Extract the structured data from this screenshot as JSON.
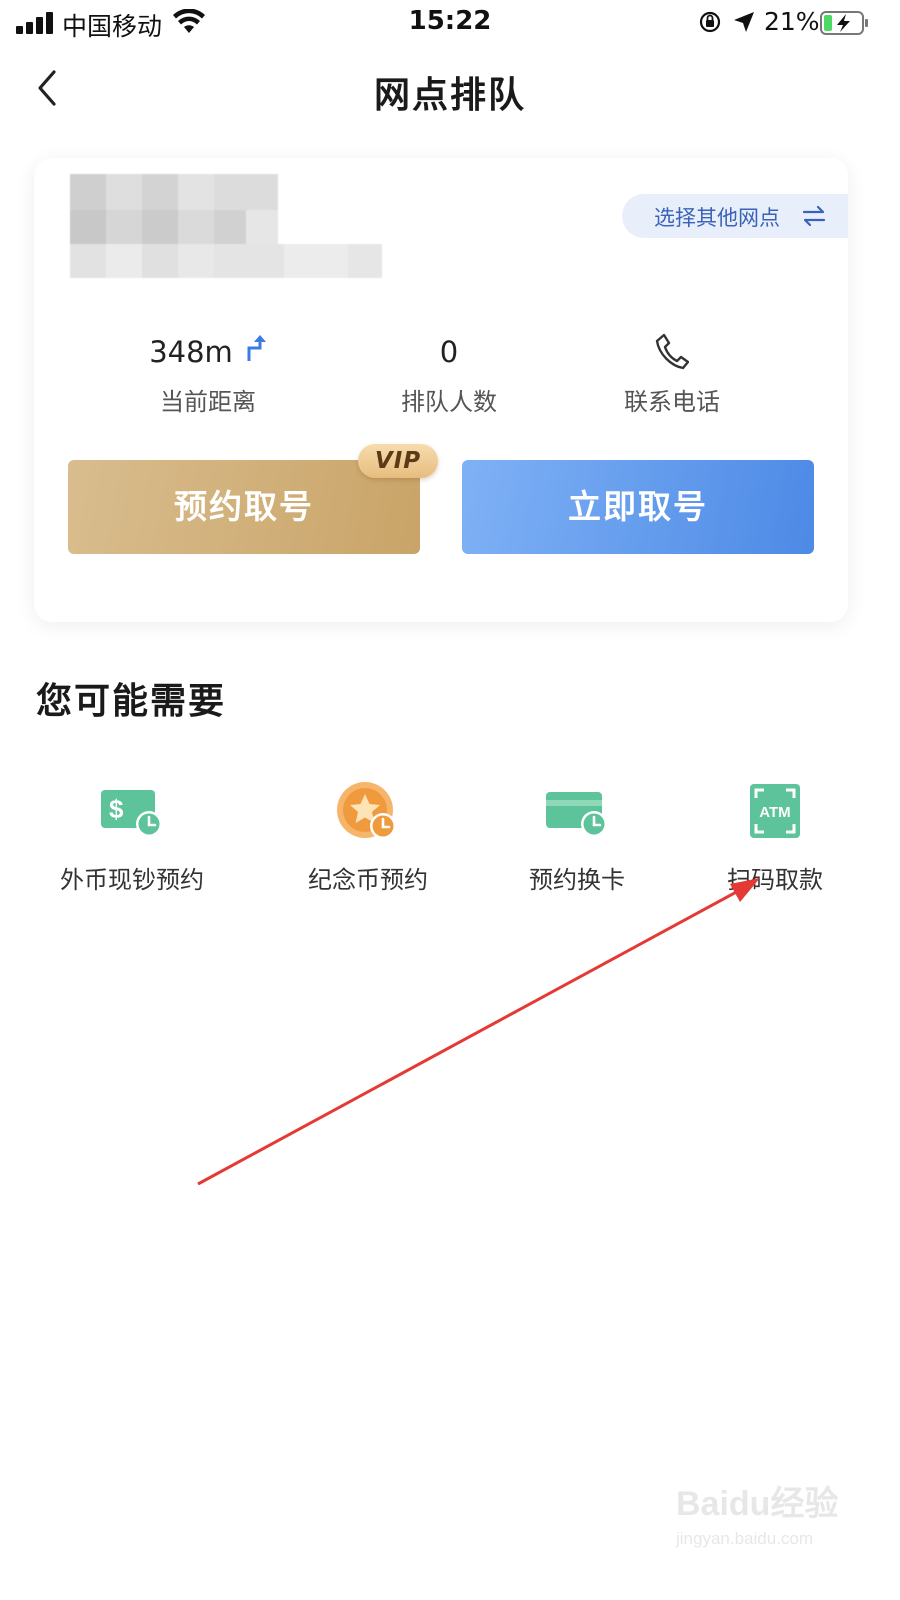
{
  "status_bar": {
    "carrier": "中国移动",
    "time": "15:22",
    "battery_percent": "21%"
  },
  "nav": {
    "title": "网点排队"
  },
  "branch_card": {
    "switch_branch_label": "选择其他网点",
    "distance_value": "348m",
    "distance_label": "当前距离",
    "queue_value": "0",
    "queue_label": "排队人数",
    "phone_label": "联系电话",
    "reserve_button": "预约取号",
    "vip_badge": "VIP",
    "take_now_button": "立即取号"
  },
  "suggestions": {
    "title": "您可能需要",
    "items": [
      {
        "label": "外币现钞预约",
        "icon": "foreign-currency-icon"
      },
      {
        "label": "纪念币预约",
        "icon": "commemorative-coin-icon"
      },
      {
        "label": "预约换卡",
        "icon": "card-replace-icon"
      },
      {
        "label": "扫码取款",
        "icon": "atm-scan-icon"
      }
    ]
  },
  "colors": {
    "reserve_gold": "#c9a468",
    "take_now_blue": "#4d8ae6",
    "service_green": "#5cc39a",
    "annotation_red": "#e53935"
  },
  "watermark": {
    "brand": "Baidu经验",
    "url": "jingyan.baidu.com"
  }
}
